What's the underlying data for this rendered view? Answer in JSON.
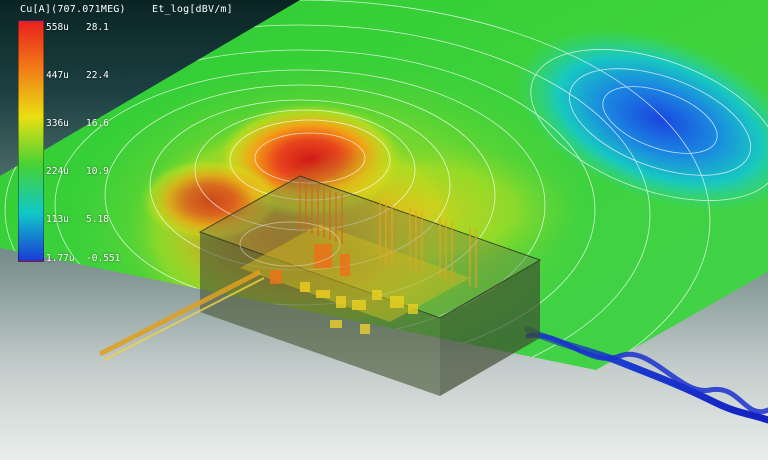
{
  "header": {
    "current_label": "Cu[A](707.071MEG)",
    "field_label": "Et_log[dBV/m]"
  },
  "legend": {
    "colors": [
      "#e8201c",
      "#f27d18",
      "#eadf12",
      "#46d235",
      "#10c8c8",
      "#1a3ad6"
    ],
    "rows": [
      {
        "current": "558u",
        "field": "28.1"
      },
      {
        "current": "447u",
        "field": "22.4"
      },
      {
        "current": "336u",
        "field": "16.6"
      },
      {
        "current": "224u",
        "field": "10.9"
      },
      {
        "current": "113u",
        "field": "5.18"
      },
      {
        "current": "1.77u",
        "field": "-0.551"
      }
    ]
  },
  "scene": {
    "plane_color": "#3ed23c",
    "hotspot_color": "#e02020",
    "cold_region_color": "#1e5ee0",
    "cable_color": "#1a2ad0",
    "housing_color": "#4a5a3a"
  }
}
